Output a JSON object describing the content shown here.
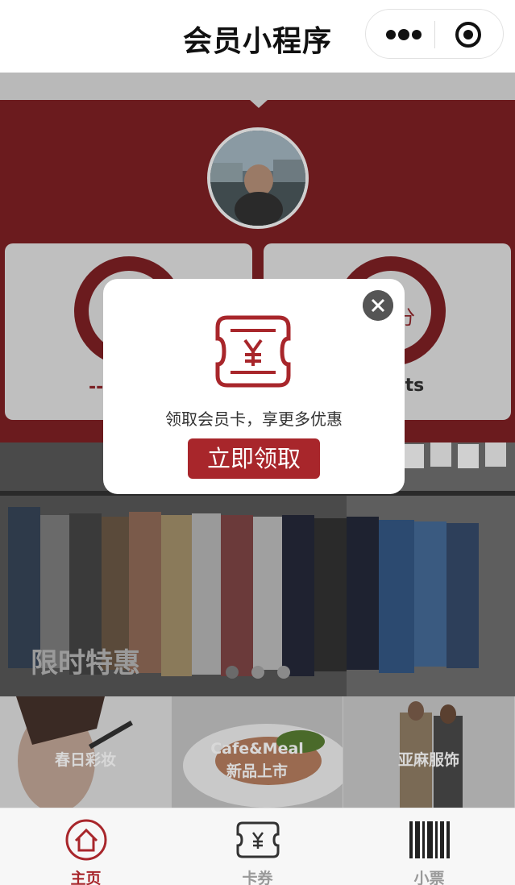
{
  "navbar": {
    "title": "会员小程序",
    "more_icon": "more-dots-icon",
    "close_icon": "target-circle-icon"
  },
  "member": {
    "avatar_icon": "user-avatar",
    "left_card_value": "--",
    "right_card_ring_text": "分",
    "right_card_label": "nts"
  },
  "banner": {
    "caption": "限时特惠",
    "dot_count": 3
  },
  "categories": [
    {
      "label_line1": "春日彩妆",
      "label_line2": ""
    },
    {
      "label_line1": "Cafe&Meal",
      "label_line2": "新品上市"
    },
    {
      "label_line1": "亚麻服饰",
      "label_line2": ""
    }
  ],
  "modal": {
    "icon": "ticket-yen-icon",
    "message": "领取会员卡，享更多优惠",
    "button_label": "立即领取",
    "close_icon": "close-icon"
  },
  "tabbar": {
    "items": [
      {
        "label": "主页",
        "icon": "home-icon",
        "active": true
      },
      {
        "label": "卡券",
        "icon": "ticket-yen-icon",
        "active": false
      },
      {
        "label": "小票",
        "icon": "barcode-icon",
        "active": false
      }
    ]
  },
  "colors": {
    "accent": "#a8262b",
    "hero_bg": "#6b1b1e",
    "tab_inactive": "#999999"
  }
}
